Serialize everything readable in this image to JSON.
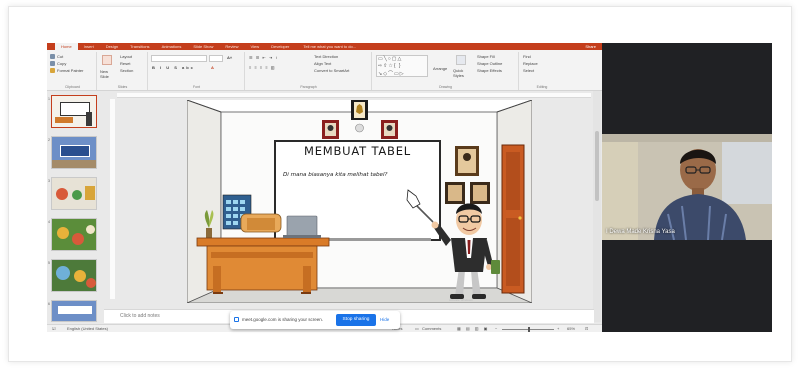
{
  "ribbon": {
    "tabs": [
      "Home",
      "Insert",
      "Design",
      "Transitions",
      "Animations",
      "Slide Show",
      "Review",
      "View",
      "Developer"
    ],
    "active_tab": "Home",
    "tell_me": "Tell me what you want to do...",
    "share": "Share",
    "clipboard": {
      "cut": "Cut",
      "copy": "Copy",
      "format_painter": "Format Painter",
      "label": "Clipboard"
    },
    "slides": {
      "new_slide": "New Slide",
      "layout": "Layout",
      "reset": "Reset",
      "section": "Section",
      "label": "Slides"
    },
    "font_label": "Font",
    "paragraph": {
      "text_direction": "Text Direction",
      "align_text": "Align Text",
      "convert_smartart": "Convert to SmartArt",
      "label": "Paragraph"
    },
    "drawing": {
      "arrange": "Arrange",
      "quick_styles": "Quick Styles",
      "shape_fill": "Shape Fill",
      "shape_outline": "Shape Outline",
      "shape_effects": "Shape Effects",
      "label": "Drawing"
    },
    "editing": {
      "find": "Find",
      "replace": "Replace",
      "select": "Select",
      "label": "Editing"
    }
  },
  "slide": {
    "title": "MEMBUAT TABEL",
    "subtitle": "Di mana biasanya kita melihat tabel?"
  },
  "notes_placeholder": "Click to add notes",
  "statusbar": {
    "language": "English (United States)",
    "notes": "Notes",
    "comments": "Comments",
    "zoom": "65%"
  },
  "screen_share": {
    "message": "meet.google.com is sharing your screen.",
    "stop_label": "Stop sharing",
    "hide_label": "Hide"
  },
  "participant": {
    "name": "I Dewa Made Krisna Yasa"
  },
  "colors": {
    "ppt_accent": "#c43e1c",
    "meet_blue": "#1a73e8"
  }
}
